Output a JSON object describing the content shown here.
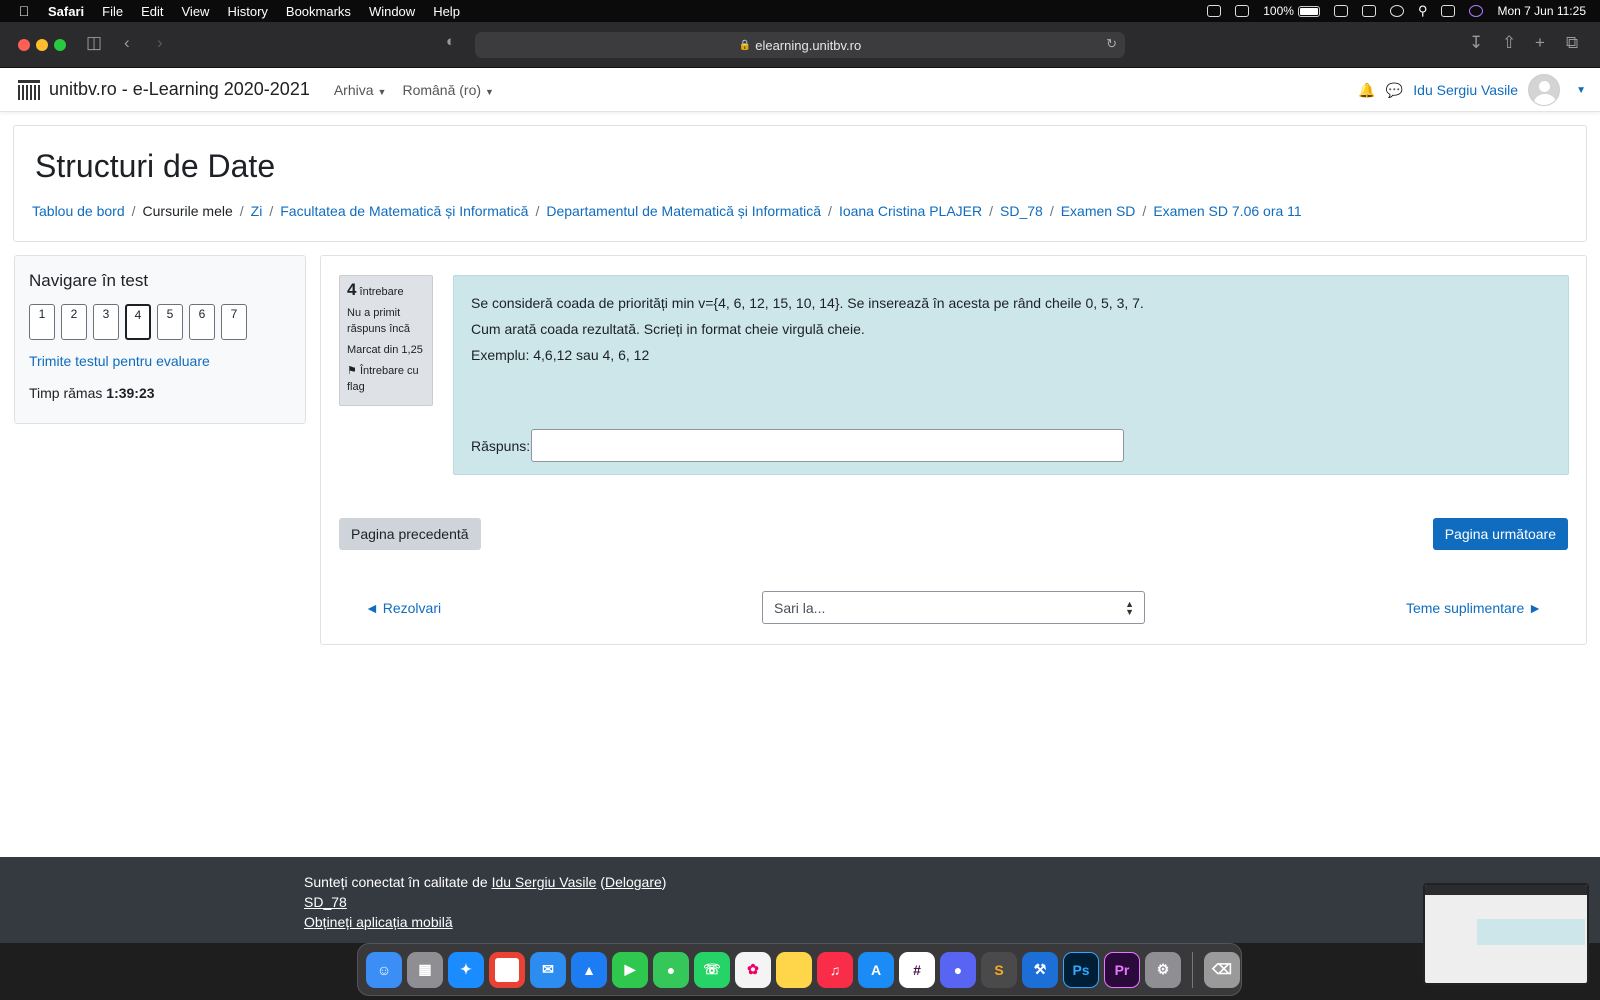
{
  "menubar": {
    "app": "Safari",
    "items": [
      "File",
      "Edit",
      "View",
      "History",
      "Bookmarks",
      "Window",
      "Help"
    ],
    "battery": "100%",
    "clock": "Mon 7 Jun  11:25"
  },
  "browser": {
    "url": "elearning.unitbv.ro"
  },
  "site": {
    "name": "unitbv.ro - e-Learning 2020-2021",
    "menu1": "Arhiva",
    "menu2": "Română (ro)",
    "user": "Idu Sergiu Vasile"
  },
  "course": {
    "title": "Structuri de Date",
    "breadcrumb": [
      "Tablou de bord",
      "Cursurile mele",
      "Zi",
      "Facultatea de Matematică și Informatică",
      "Departamentul de Matematică și Informatică",
      "Ioana Cristina PLAJER",
      "SD_78",
      "Examen SD",
      "Examen SD 7.06 ora 11"
    ]
  },
  "quiznav": {
    "title": "Navigare în test",
    "buttons": [
      "1",
      "2",
      "3",
      "4",
      "5",
      "6",
      "7"
    ],
    "current": "4",
    "submit": "Trimite testul pentru evaluare",
    "timer_label": "Timp rămas",
    "timer_value": "1:39:23"
  },
  "question": {
    "number": "4",
    "label": "întrebare",
    "status": "Nu a primit răspuns încă",
    "marks": "Marcat din 1,25",
    "flag": "Întrebare cu flag",
    "line1": "Se consideră coada de priorități min v={4, 6, 12, 15, 10, 14}. Se inserează în acesta pe rând cheile 0, 5, 3, 7.",
    "line2": "Cum arată coada rezultată. Scrieți in format cheie virgulă cheie.",
    "line3": "Exemplu: 4,6,12 sau 4, 6, 12",
    "answer_label": "Răspuns:",
    "answer_value": ""
  },
  "nav": {
    "prev_page": "Pagina precedentă",
    "next_page": "Pagina următoare",
    "prev_activity": "◄ Rezolvari",
    "jump": "Sari la...",
    "next_activity": "Teme suplimentare ►"
  },
  "footer": {
    "logged_prefix": "Sunteți conectat în calitate de",
    "logged_user": "Idu Sergiu Vasile",
    "logout": "Delogare",
    "course_link": "SD_78",
    "mobile": "Obțineți aplicația mobilă"
  },
  "dock": [
    "Finder",
    "Launchpad",
    "Safari",
    "Chrome",
    "Mail",
    "Maps",
    "FaceTime",
    "Messages",
    "WhatsApp",
    "Photos",
    "Notes",
    "Music",
    "App Store",
    "Slack",
    "Discord",
    "Sublime Text",
    "Xcode",
    "Ps",
    "Pr",
    "System Preferences",
    "Trash"
  ]
}
